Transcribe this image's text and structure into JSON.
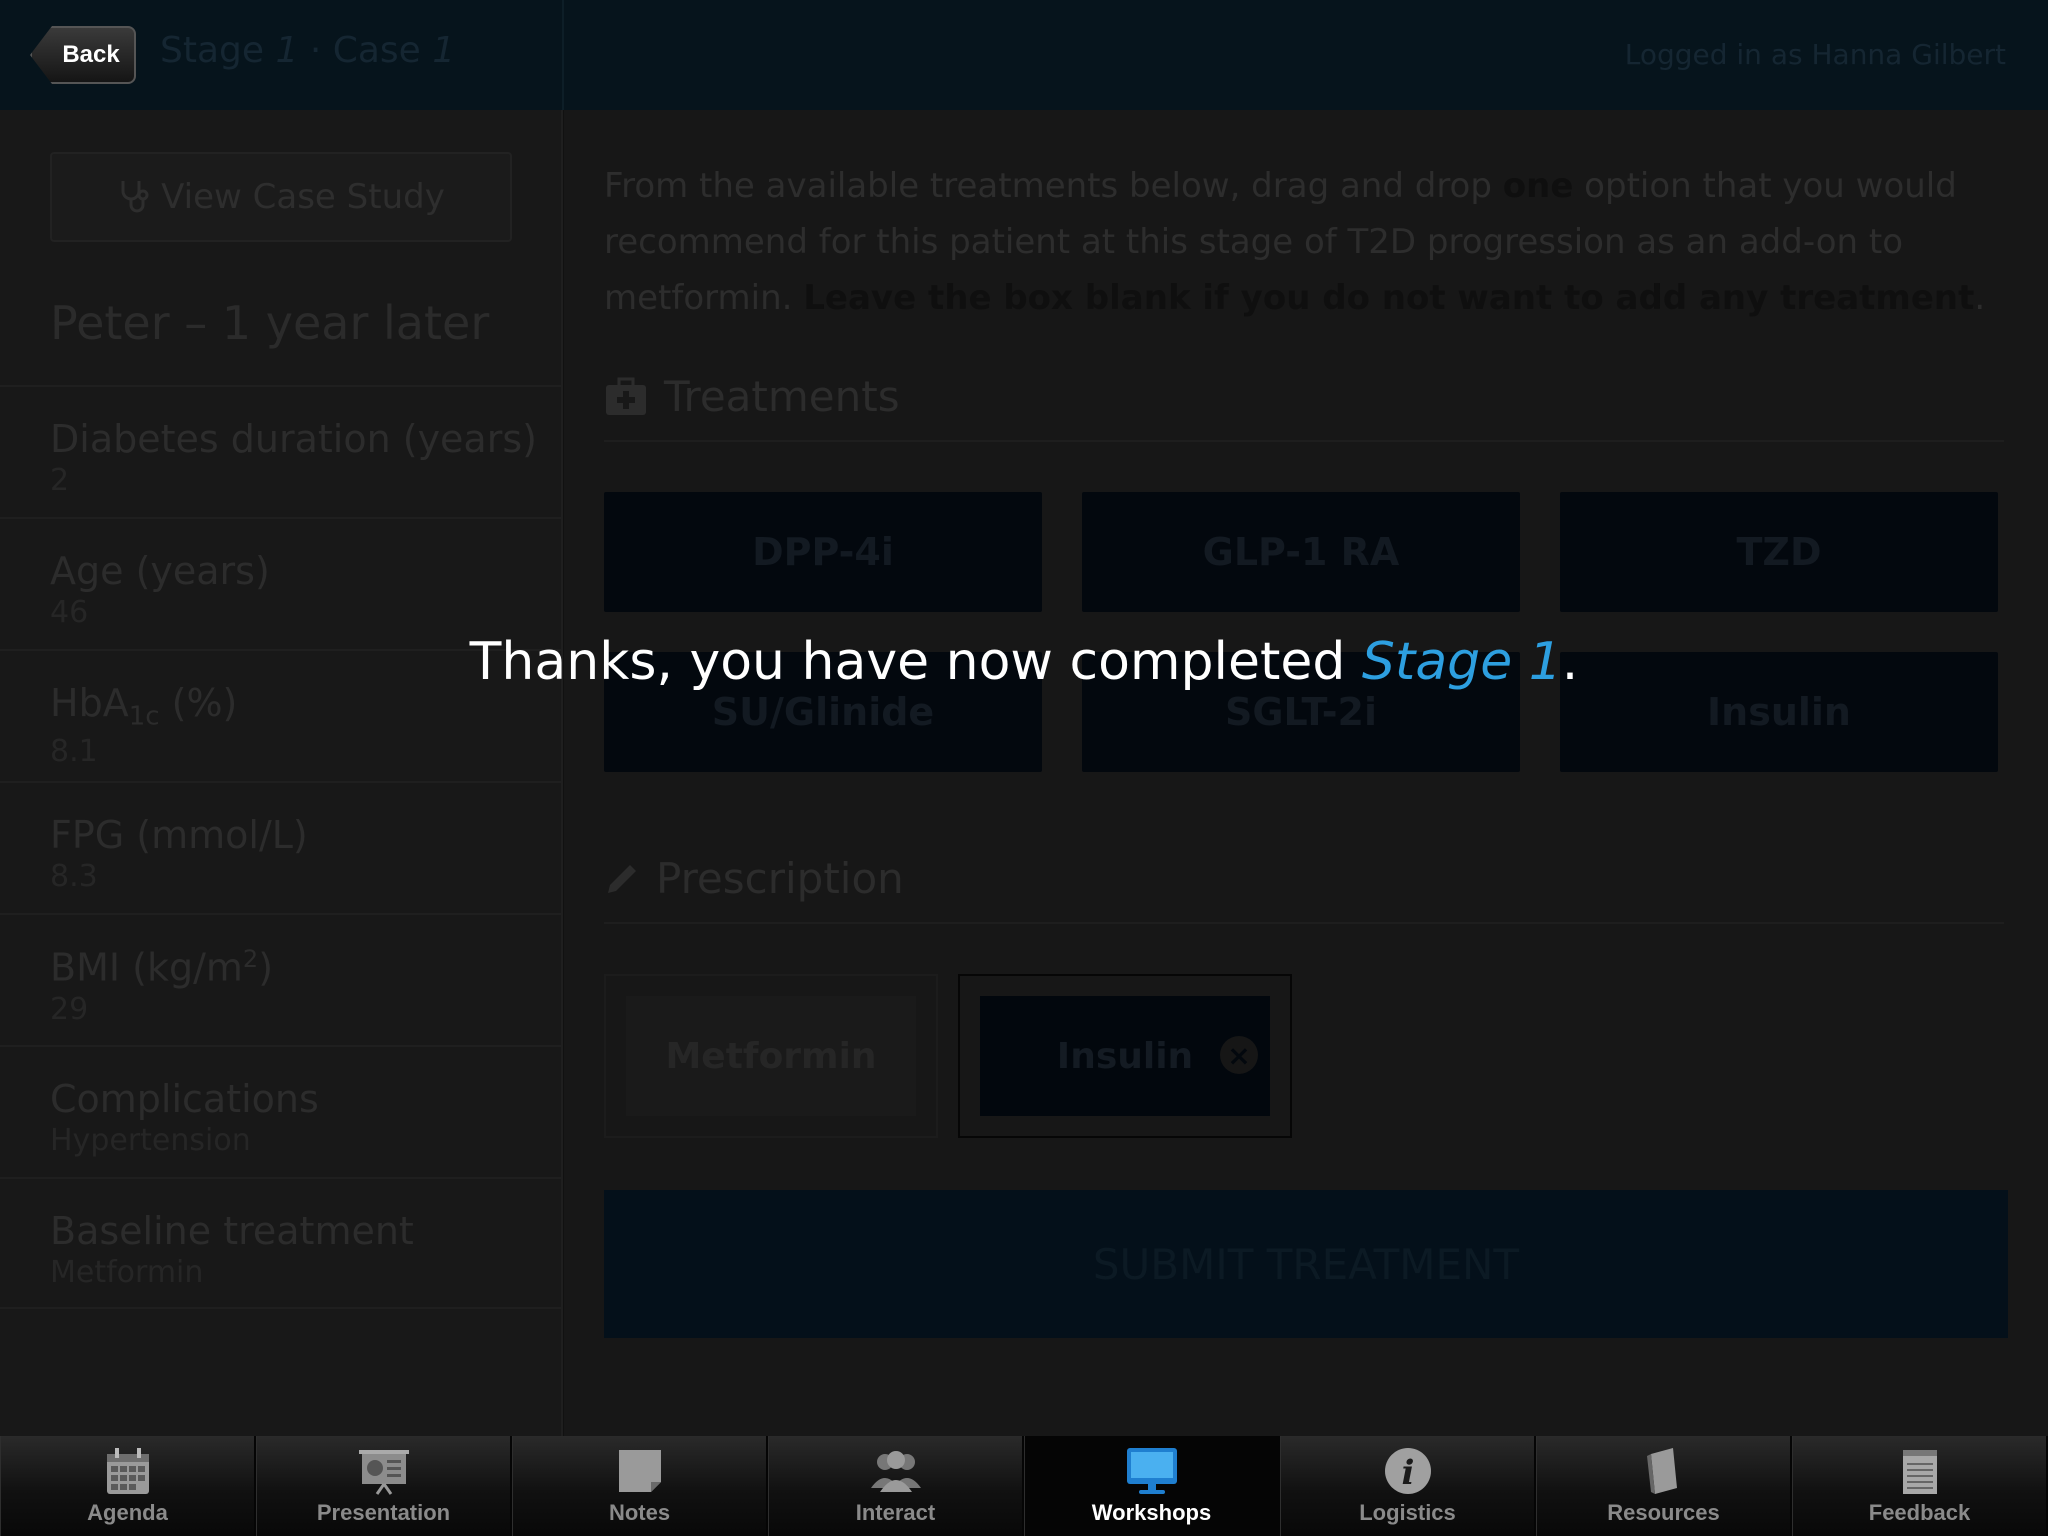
{
  "header": {
    "back_label": "Back",
    "title_stage_word": "Stage ",
    "title_stage_num": "1",
    "title_sep": " · Case ",
    "title_case_num": "1",
    "user": "Logged in as Hanna Gilbert"
  },
  "sidebar": {
    "view_case_label": "View Case Study",
    "heading": "Peter – 1 year later",
    "rows": [
      {
        "label": "Diabetes duration (years)",
        "value": "2"
      },
      {
        "label": "Age (years)",
        "value": "46"
      },
      {
        "label_main": "HbA",
        "label_sub": "1c",
        "label_tail": " (%)",
        "value": "8.1"
      },
      {
        "label": "FPG (mmol/L)",
        "value": "8.3"
      },
      {
        "label_main": "BMI (kg/m",
        "label_sup": "2",
        "label_tail": ")",
        "value": "29"
      },
      {
        "label": "Complications",
        "value": "Hypertension"
      },
      {
        "label": "Baseline treatment",
        "value": "Metformin"
      }
    ]
  },
  "main": {
    "instr_part1": "From the available treatments below, drag and drop ",
    "instr_bold1": "one",
    "instr_part2": " option that you would recommend for this patient at this stage of T2D progression as an add-on to metformin. ",
    "instr_bold2": "Leave the box blank if you do not want to add any treatment",
    "instr_end": ".",
    "treatments_title": "Treatments",
    "treatments": [
      "DPP-4i",
      "GLP-1 RA",
      "TZD",
      "SU/Glinide",
      "SGLT-2i",
      "Insulin"
    ],
    "prescription_title": "Prescription",
    "prescription": [
      "Metformin",
      "Insulin"
    ],
    "submit_label": "SUBMIT TREATMENT"
  },
  "overlay": {
    "text_before": "Thanks, you have now completed ",
    "stage": "Stage 1",
    "text_after": "."
  },
  "tabs": [
    {
      "label": "Agenda",
      "icon": "calendar-icon"
    },
    {
      "label": "Presentation",
      "icon": "presentation-icon"
    },
    {
      "label": "Notes",
      "icon": "notes-icon"
    },
    {
      "label": "Interact",
      "icon": "people-icon"
    },
    {
      "label": "Workshops",
      "icon": "monitor-icon",
      "active": true
    },
    {
      "label": "Logistics",
      "icon": "info-icon"
    },
    {
      "label": "Resources",
      "icon": "book-icon"
    },
    {
      "label": "Feedback",
      "icon": "notepad-icon"
    }
  ],
  "colors": {
    "accent": "#2d9fe0",
    "header_bg": "#06141c",
    "treatment_bg": "#03080e"
  }
}
